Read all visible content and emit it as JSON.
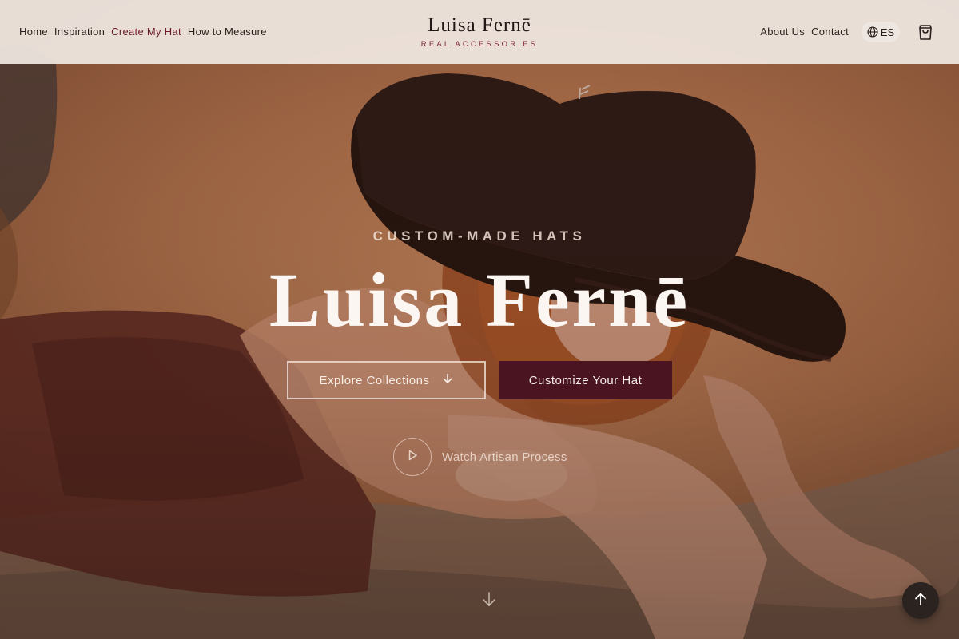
{
  "header": {
    "nav_left": [
      {
        "label": "Home",
        "active": false
      },
      {
        "label": "Inspiration",
        "active": false
      },
      {
        "label": "Create My Hat",
        "active": true
      },
      {
        "label": "How to Measure",
        "active": false
      }
    ],
    "brand_name": "Luisa Fernē",
    "brand_tagline": "REAL ACCESSORIES",
    "nav_right": [
      {
        "label": "About Us"
      },
      {
        "label": "Contact"
      }
    ],
    "language": {
      "label": "ES",
      "icon": "globe-icon"
    },
    "cart_icon": "shopping-bag-icon"
  },
  "hero": {
    "eyebrow": "CUSTOM-MADE HATS",
    "title": "Luisa Fernē",
    "primary_button": {
      "label": "Explore Collections",
      "icon": "arrow-down-icon"
    },
    "secondary_button": {
      "label": "Customize Your Hat"
    },
    "video_link": {
      "label": "Watch Artisan Process",
      "icon": "play-icon"
    },
    "scroll_icon": "arrow-down-icon",
    "back_to_top_icon": "arrow-up-icon"
  },
  "colors": {
    "accent": "#6b1a2b",
    "button_solid": "#4a1420",
    "header_bg": "#f0e8e2",
    "text_dark": "#2a1f1c"
  }
}
